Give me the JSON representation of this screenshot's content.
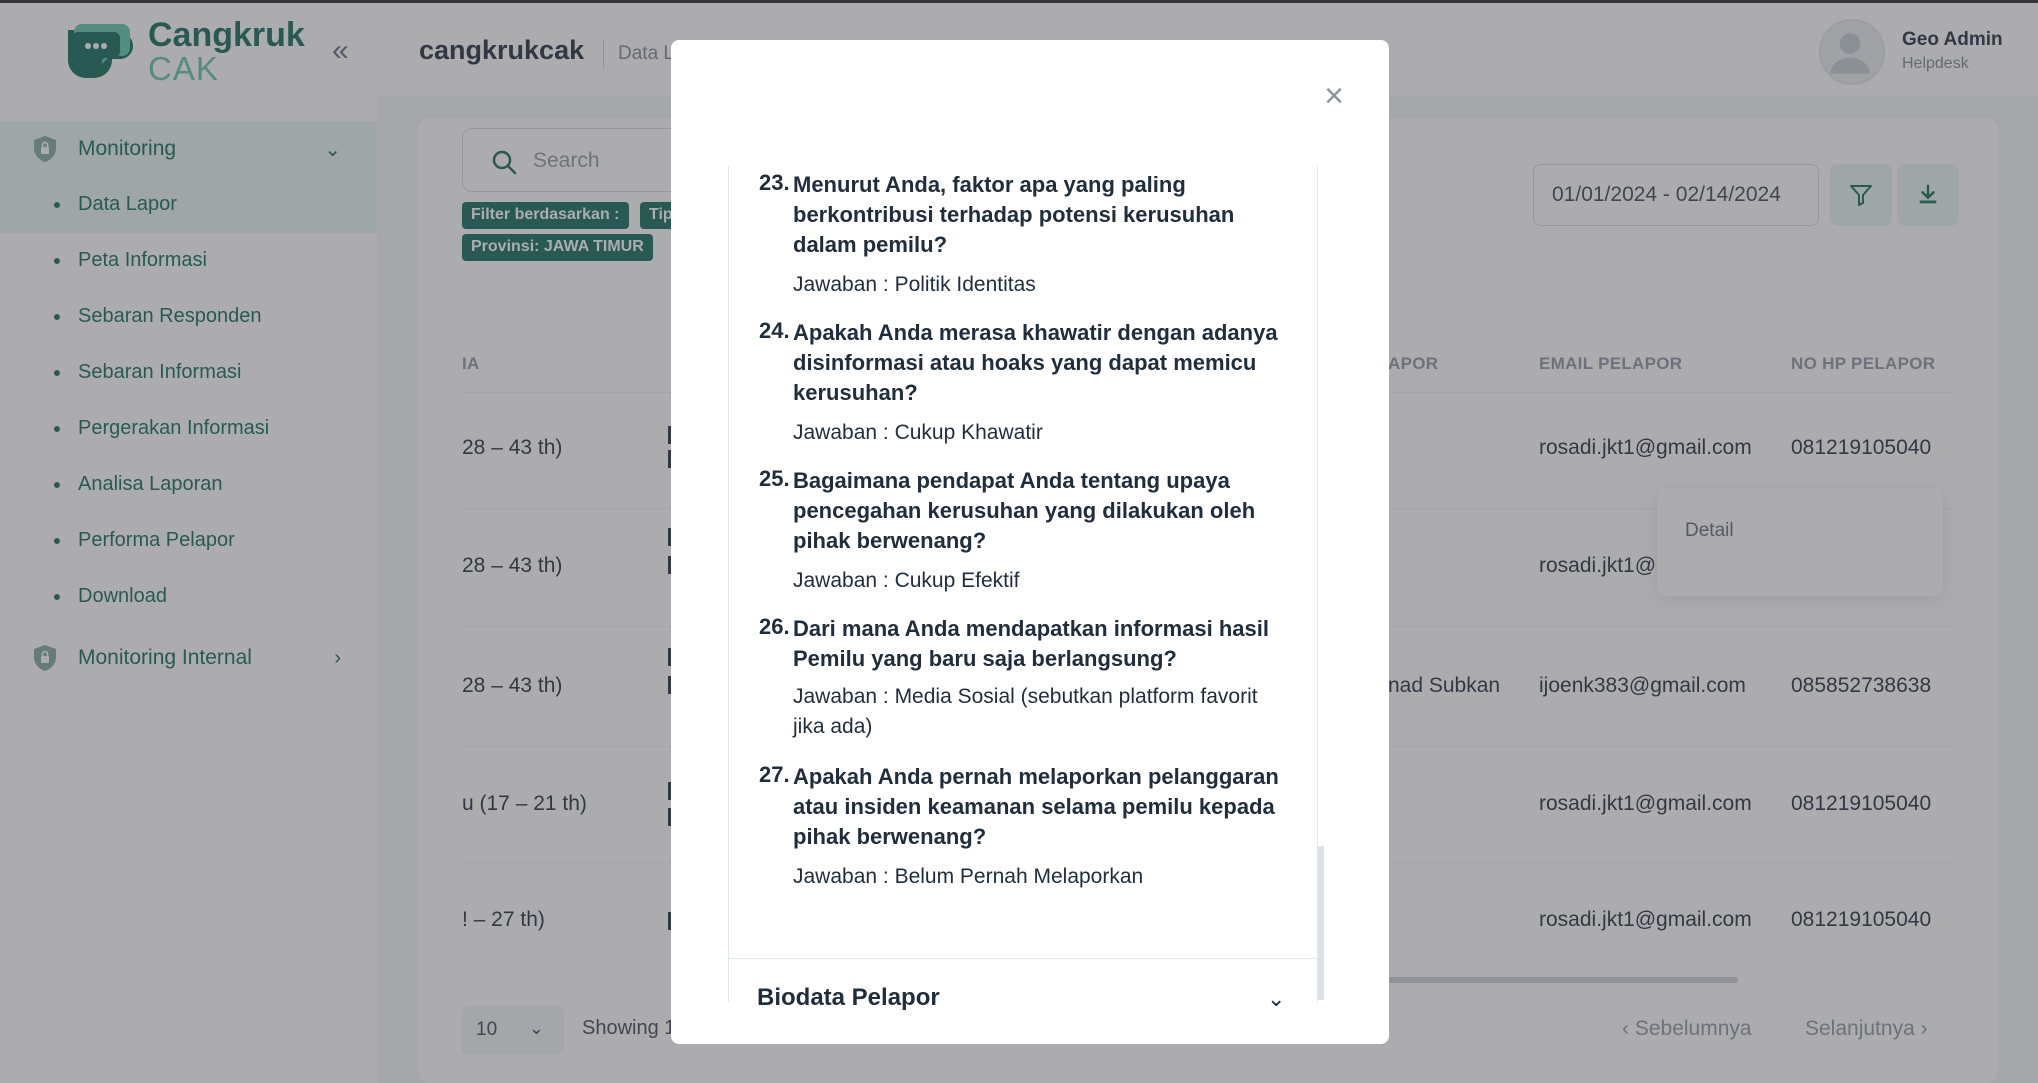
{
  "sidebar": {
    "logo_line1": "Cangkruk",
    "logo_line2": "CAK",
    "collapse_icon": "double-chevron-left",
    "groups": [
      {
        "label": "Monitoring",
        "icon": "shield-lock",
        "expanded": true
      },
      {
        "label": "Monitoring Internal",
        "icon": "shield-lock",
        "expanded": false
      }
    ],
    "items": [
      {
        "label": "Data Lapor",
        "active": true
      },
      {
        "label": "Peta Informasi"
      },
      {
        "label": "Sebaran Responden"
      },
      {
        "label": "Sebaran Informasi"
      },
      {
        "label": "Pergerakan Informasi"
      },
      {
        "label": "Analisa Laporan"
      },
      {
        "label": "Performa Pelapor"
      },
      {
        "label": "Download"
      }
    ]
  },
  "header": {
    "title": "cangkrukcak",
    "breadcrumb": "Data L",
    "user_name": "Geo Admin",
    "user_role": "Helpdesk"
  },
  "toolbar": {
    "search_placeholder": "Search",
    "chip_filter": "Filter berdasarkan :",
    "chip_tipe": "Tip",
    "chip_provinsi": "Provinsi: JAWA TIMUR",
    "date_range": "01/01/2024 - 02/14/2024"
  },
  "table": {
    "headers": {
      "col_usia": "IA",
      "col_nama": "APOR",
      "col_email": "EMAIL PELAPOR",
      "col_hp": "NO HP PELAPOR"
    },
    "rows": [
      {
        "usia": "28 – 43 th)",
        "nama": "",
        "email": "rosadi.jkt1@gmail.com",
        "hp": "081219105040"
      },
      {
        "usia": "28 – 43 th)",
        "nama": "",
        "email": "rosadi.jkt1@",
        "hp": ""
      },
      {
        "usia": "28 – 43 th)",
        "nama": "nad Subkan",
        "email": "ijoenk383@gmail.com",
        "hp": "085852738638"
      },
      {
        "usia": "u (17 – 21 th)",
        "nama": "",
        "email": "rosadi.jkt1@gmail.com",
        "hp": "081219105040"
      },
      {
        "usia": "! – 27 th)",
        "nama": "",
        "email": "rosadi.jkt1@gmail.com",
        "hp": "081219105040"
      }
    ],
    "row_menu_item": "Detail"
  },
  "footer": {
    "per_page": "10",
    "showing": "Showing 1",
    "prev": "‹ Sebelumnya",
    "next": "Selanjutnya ›"
  },
  "modal": {
    "close_icon": "×",
    "questions": [
      {
        "num": "23.",
        "q": "Menurut Anda, faktor apa yang paling berkontribusi terhadap potensi kerusuhan dalam pemilu?",
        "a": "Jawaban : Politik Identitas"
      },
      {
        "num": "24.",
        "q": "Apakah Anda merasa khawatir dengan adanya disinformasi atau hoaks yang dapat memicu kerusuhan?",
        "a": "Jawaban : Cukup Khawatir"
      },
      {
        "num": "25.",
        "q": "Bagaimana pendapat Anda tentang upaya pencegahan kerusuhan yang dilakukan oleh pihak berwenang?",
        "a": "Jawaban : Cukup Efektif"
      },
      {
        "num": "26.",
        "q": "Dari mana Anda mendapatkan informasi hasil Pemilu yang baru saja berlangsung?",
        "a": "Jawaban : Media Sosial (sebutkan platform favorit jika ada)"
      },
      {
        "num": "27.",
        "q": "Apakah Anda pernah melaporkan pelanggaran atau insiden keamanan selama pemilu kepada pihak berwenang?",
        "a": "Jawaban : Belum Pernah Melaporkan"
      }
    ],
    "section_biodata": "Biodata Pelapor"
  },
  "colors": {
    "brand_dark": "#0f6b5a",
    "brand_light": "#5fc5ac",
    "active_bg": "#e6f4f1",
    "overlay": "rgba(70,72,76,0.45)"
  }
}
